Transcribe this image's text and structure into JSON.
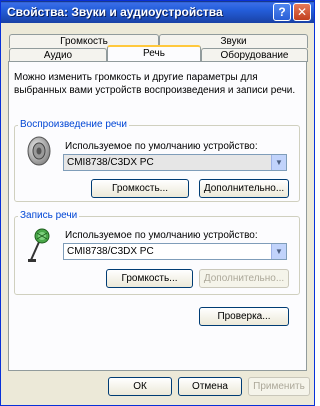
{
  "window": {
    "title": "Свойства: Звуки и аудиоустройства",
    "help_label": "?",
    "close_label": "✕"
  },
  "tabs": {
    "back": [
      {
        "label": "Громкость"
      },
      {
        "label": "Звуки"
      }
    ],
    "front": [
      {
        "label": "Аудио"
      },
      {
        "label": "Речь",
        "active": true
      },
      {
        "label": "Оборудование"
      }
    ]
  },
  "intro_text": "Можно изменить громкость и другие параметры для выбранных вами устройств воспроизведения и записи речи.",
  "playback": {
    "group_title": "Воспроизведение речи",
    "device_label": "Используемое по умолчанию устройство:",
    "device_value": "CMI8738/C3DX PC",
    "volume_button": "Громкость...",
    "advanced_button": "Дополнительно...",
    "icon": "speaker-icon"
  },
  "recording": {
    "group_title": "Запись речи",
    "device_label": "Используемое по умолчанию устройство:",
    "device_value": "CMI8738/C3DX PC",
    "volume_button": "Громкость...",
    "advanced_button": "Дополнительно...",
    "icon": "microphone-icon"
  },
  "test_button": "Проверка...",
  "footer": {
    "ok": "ОК",
    "cancel": "Отмена",
    "apply": "Применить"
  }
}
